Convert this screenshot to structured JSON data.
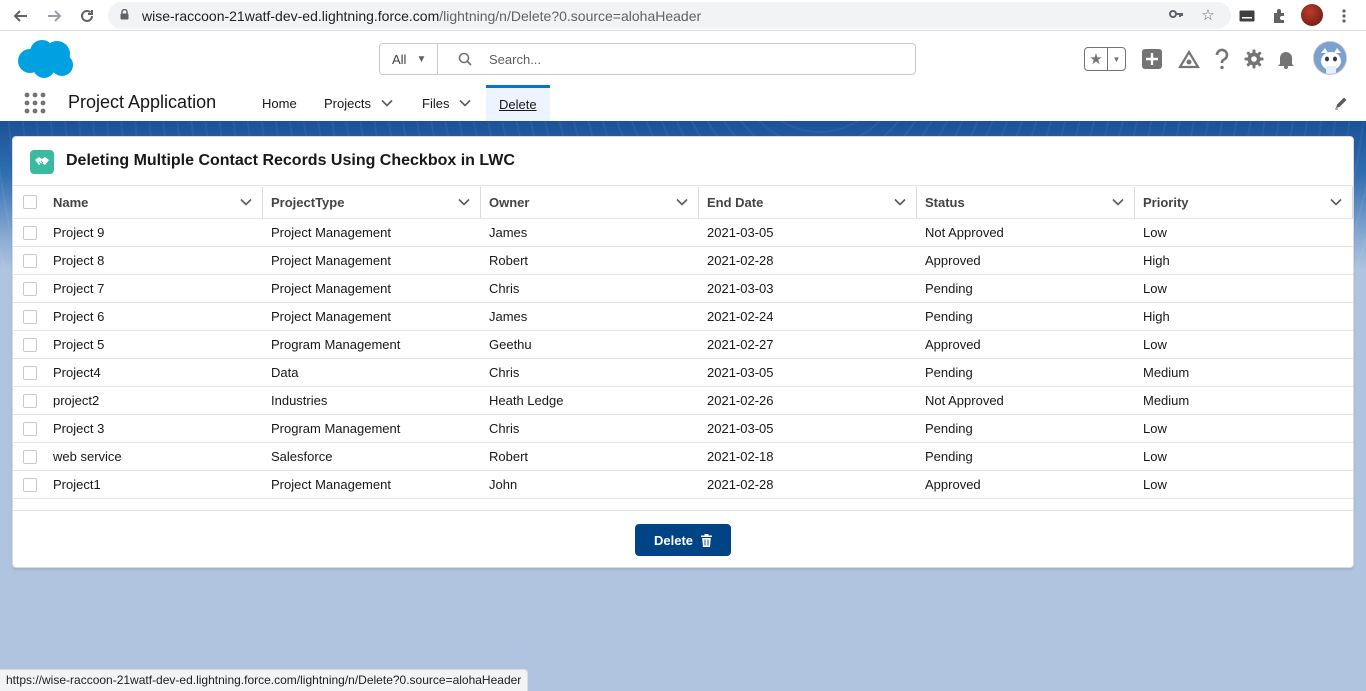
{
  "browser": {
    "url_host": "wise-raccoon-21watf-dev-ed.lightning.force.com",
    "url_path": "/lightning/n/Delete?0.source=alohaHeader",
    "status_url": "https://wise-raccoon-21watf-dev-ed.lightning.force.com/lightning/n/Delete?0.source=alohaHeader"
  },
  "header": {
    "search_scope": "All",
    "search_placeholder": "Search..."
  },
  "app": {
    "name": "Project Application",
    "nav": [
      {
        "label": "Home"
      },
      {
        "label": "Projects"
      },
      {
        "label": "Files"
      },
      {
        "label": "Delete"
      }
    ]
  },
  "card": {
    "title": "Deleting Multiple Contact Records Using Checkbox in LWC",
    "columns": [
      "Name",
      "ProjectType",
      "Owner",
      "End Date",
      "Status",
      "Priority"
    ],
    "rows": [
      [
        "Project 9",
        "Project Management",
        "James",
        "2021-03-05",
        "Not Approved",
        "Low"
      ],
      [
        "Project 8",
        "Project Management",
        "Robert",
        "2021-02-28",
        "Approved",
        "High"
      ],
      [
        "Project 7",
        "Project Management",
        "Chris",
        "2021-03-03",
        "Pending",
        "Low"
      ],
      [
        "Project 6",
        "Project Management",
        "James",
        "2021-02-24",
        "Pending",
        "High"
      ],
      [
        "Project 5",
        "Program Management",
        "Geethu",
        "2021-02-27",
        "Approved",
        "Low"
      ],
      [
        "Project4",
        "Data",
        "Chris",
        "2021-03-05",
        "Pending",
        "Medium"
      ],
      [
        "project2",
        "Industries",
        "Heath Ledge",
        "2021-02-26",
        "Not Approved",
        "Medium"
      ],
      [
        "Project 3",
        "Program Management",
        "Chris",
        "2021-03-05",
        "Pending",
        "Low"
      ],
      [
        "web service",
        "Salesforce",
        "Robert",
        "2021-02-18",
        "Pending",
        "Low"
      ],
      [
        "Project1",
        "Project Management",
        "John",
        "2021-02-28",
        "Approved",
        "Low"
      ]
    ],
    "delete_label": "Delete"
  },
  "colors": {
    "brand_blue": "#0176d3",
    "button_blue": "#014486",
    "card_icon_teal": "#3bba9f",
    "salesforce_cloud": "#00a1e0"
  },
  "icons": [
    "back-icon",
    "forward-icon",
    "reload-icon",
    "lock-icon",
    "key-icon",
    "bookmark-star-icon",
    "media-icon",
    "extensions-icon",
    "menu-dots-icon",
    "salesforce-cloud-icon",
    "search-icon",
    "favorites-star-icon",
    "add-icon",
    "trailhead-icon",
    "help-icon",
    "setup-gear-icon",
    "bell-icon",
    "app-launcher-icon",
    "chevron-down-icon",
    "edit-pencil-icon",
    "handshake-icon",
    "trash-icon"
  ]
}
